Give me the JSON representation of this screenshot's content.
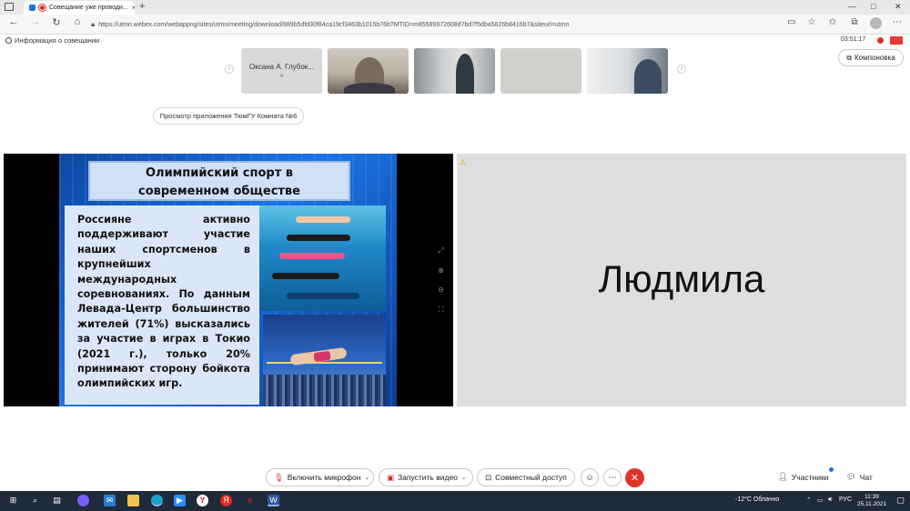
{
  "browser": {
    "tab_title": "Совещание уже проводи...",
    "tab_close": "×",
    "new_tab": "+",
    "url": "https://utmn.webex.com/webappng/sites/utmn/meeting/download/889b5dfd30f84ca19cf3463b1015b76b?MTID=m85589972608d7bd7f5dba5826b8416b7&siteurl=utmn",
    "window_controls": [
      "—",
      "□",
      "✕"
    ]
  },
  "meeting": {
    "info_label": "Информация о совещании",
    "timer": "03:51:17",
    "layout_button": "Компоновка",
    "preview_label": "Просмотр приложения ТюмГУ Комната №6",
    "thumbnails": [
      {
        "name": "Оксана А. Глубок...",
        "sub": "я"
      }
    ],
    "participant_name": "Людмила"
  },
  "slide": {
    "title_line1": "Олимпийский спорт в",
    "title_line2": "современном обществе",
    "body": "Россияне активно поддерживают участие наших спортсменов в крупнейших международных соревнованиях. По данным Левада-Центр большинство жителей (71%) высказались за участие в играх в Токио (2021 г.), только 20% принимают сторону бойкота олимпийских игр."
  },
  "controls": {
    "mic": "Включить микрофон",
    "video": "Запустить видео",
    "share": "Совместный доступ",
    "participants": "Участники",
    "chat": "Чат"
  },
  "taskbar": {
    "weather": "-12°C  Облачно",
    "lang": "РУС",
    "time": "11:39",
    "date": "25.11.2021"
  },
  "colors": {
    "accent_red": "#d93025",
    "slide_blue": "#1a73e8",
    "taskbar": "#1f2b3a"
  }
}
